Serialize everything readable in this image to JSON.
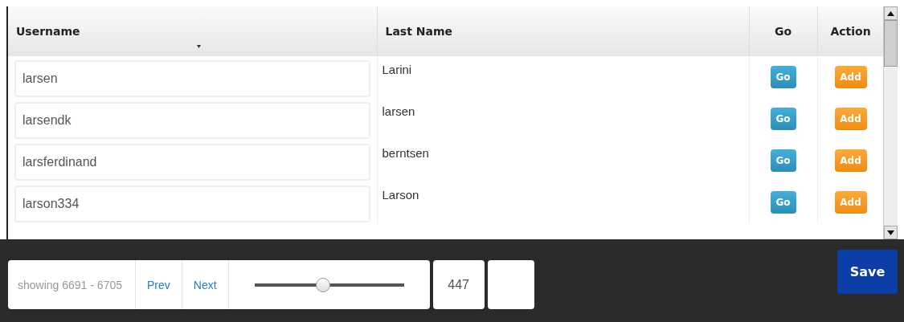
{
  "table": {
    "columns": [
      {
        "label": "Username",
        "sorted": true
      },
      {
        "label": "Last Name",
        "sorted": false
      },
      {
        "label": "Go",
        "sorted": false
      },
      {
        "label": "Action",
        "sorted": false
      }
    ],
    "rows": [
      {
        "username": "larsen",
        "last_name": "Larini",
        "go": "Go",
        "action": "Add"
      },
      {
        "username": "larsendk",
        "last_name": "larsen",
        "go": "Go",
        "action": "Add"
      },
      {
        "username": "larsferdinand",
        "last_name": "berntsen",
        "go": "Go",
        "action": "Add"
      },
      {
        "username": "larson334",
        "last_name": "Larson",
        "go": "Go",
        "action": "Add"
      }
    ]
  },
  "pager": {
    "range": "showing 6691 - 6705",
    "prev": "Prev",
    "next": "Next",
    "slider": {
      "level": 0.46
    },
    "page": "447"
  },
  "save_button": "Save"
}
